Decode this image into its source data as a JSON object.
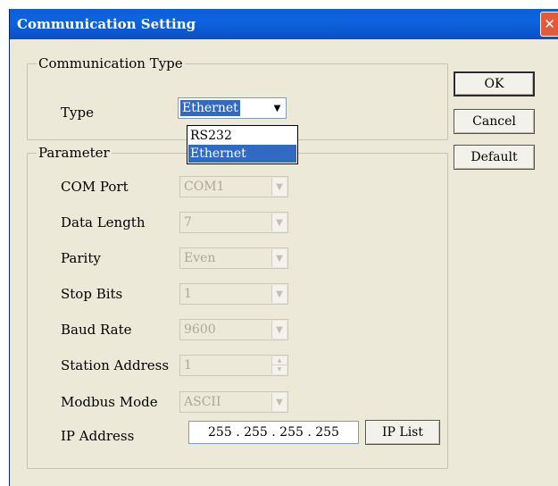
{
  "window": {
    "title": "Communication Setting",
    "close_glyph": "✕"
  },
  "comm_type": {
    "legend": "Communication Type",
    "type_label": "Type",
    "selected": "Ethernet",
    "options": [
      "RS232",
      "Ethernet"
    ],
    "highlighted_option": "Ethernet"
  },
  "buttons": {
    "ok": "OK",
    "cancel": "Cancel",
    "default": "Default",
    "ip_list": "IP List"
  },
  "parameter": {
    "legend": "Parameter",
    "com_port": {
      "label": "COM Port",
      "value": "COM1",
      "enabled": false
    },
    "data_length": {
      "label": "Data Length",
      "value": "7",
      "enabled": false
    },
    "parity": {
      "label": "Parity",
      "value": "Even",
      "enabled": false
    },
    "stop_bits": {
      "label": "Stop Bits",
      "value": "1",
      "enabled": false
    },
    "baud_rate": {
      "label": "Baud Rate",
      "value": "9600",
      "enabled": false
    },
    "station_address": {
      "label": "Station Address",
      "value": "1",
      "enabled": false
    },
    "modbus_mode": {
      "label": "Modbus Mode",
      "value": "ASCII",
      "enabled": false
    },
    "ip_address": {
      "label": "IP Address",
      "value": "255 . 255 . 255 . 255",
      "enabled": true
    }
  },
  "icons": {
    "close": "close-icon",
    "dropdown_arrow": "chevron-down-icon",
    "spin_up": "chevron-up-icon",
    "spin_down": "chevron-down-icon"
  }
}
